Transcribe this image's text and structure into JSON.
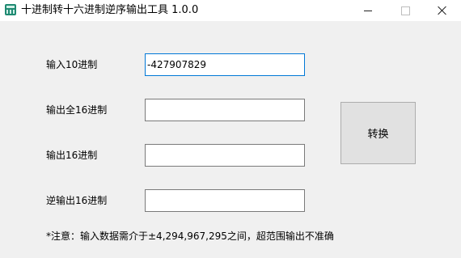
{
  "window": {
    "title": "十进制转十六进制逆序输出工具 1.0.0",
    "icon": "calculator-icon",
    "controls": {
      "minimize": "minimize-icon",
      "maximize": "maximize-icon",
      "close": "close-icon"
    }
  },
  "form": {
    "decimal_input_label": "输入10进制",
    "decimal_input_value": "-427907829",
    "full_hex_label": "输出全16进制",
    "full_hex_value": "",
    "hex_label": "输出16进制",
    "hex_value": "",
    "reverse_hex_label": "逆输出16进制",
    "reverse_hex_value": ""
  },
  "convert_button_label": "转换",
  "note": "*注意：输入数据需介于±4,294,967,295之间，超范围输出不准确",
  "colors": {
    "focus_border": "#0078d7",
    "app_icon": "#1f8a72"
  }
}
